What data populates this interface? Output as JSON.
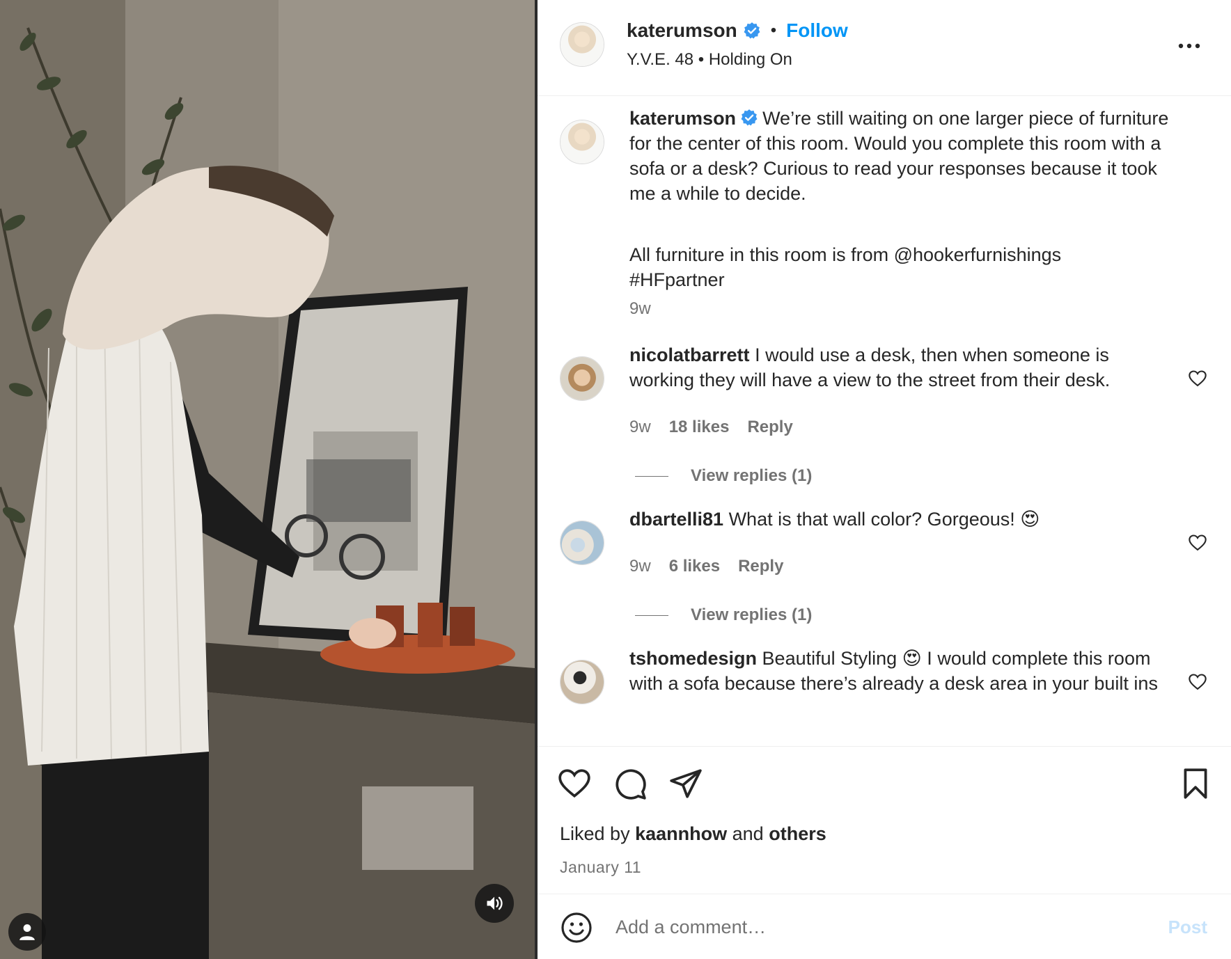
{
  "header": {
    "username": "katerumson",
    "separator": "•",
    "follow_label": "Follow",
    "audio": "Y.V.E. 48 • Holding On"
  },
  "caption": {
    "username": "katerumson",
    "text1": "We’re still waiting on one larger piece of furniture for the center of this room. Would you complete this room with a sofa or a desk? Curious to read your responses because it took me a while to decide.",
    "text2": "All furniture in this room is from @hookerfurnishings #HFpartner",
    "time": "9w"
  },
  "comments": [
    {
      "username": "nicolatbarrett",
      "text": "I would use a desk, then when someone is working they will have a view to the street from their desk.",
      "time": "9w",
      "likes": "18 likes",
      "reply_label": "Reply",
      "view_replies": "View replies (1)"
    },
    {
      "username": "dbartelli81",
      "text": "What is that wall color? Gorgeous! 😍",
      "time": "9w",
      "likes": "6 likes",
      "reply_label": "Reply",
      "view_replies": "View replies (1)"
    },
    {
      "username": "tshomedesign",
      "text": "Beautiful Styling 😍 I would complete this room with a sofa because there’s already a desk area in your built ins"
    }
  ],
  "footer": {
    "liked_prefix": "Liked by",
    "liked_user": "kaannhow",
    "liked_and": "and",
    "liked_others": "others",
    "date": "January 11",
    "comment_placeholder": "Add a comment…",
    "post_label": "Post"
  },
  "icons": [
    "user-icon",
    "sound-icon",
    "verified-icon",
    "more-icon",
    "heart-icon",
    "comment-icon",
    "share-icon",
    "bookmark-icon",
    "emoji-icon"
  ],
  "colors": {
    "accent": "#0095f6",
    "verified": "#3897f0",
    "muted_text": "#737373",
    "post_disabled": "#c7e3fb"
  }
}
